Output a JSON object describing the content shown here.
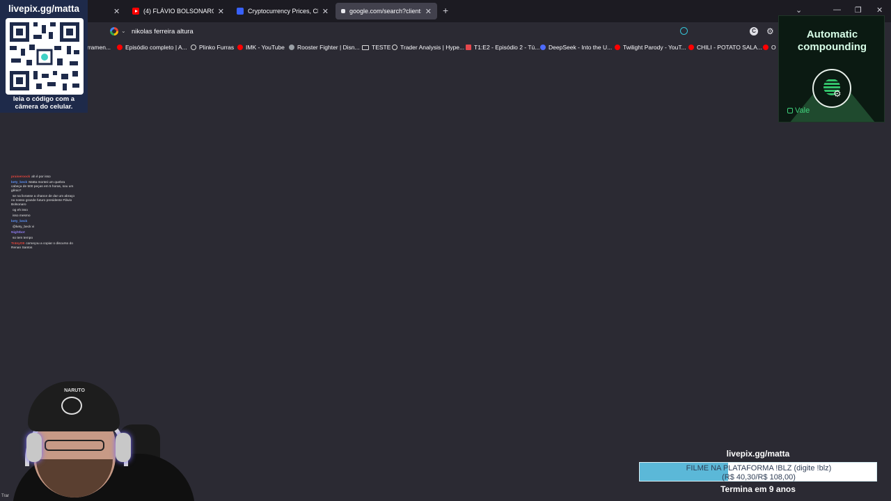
{
  "browser": {
    "tabs": [
      {
        "title": "(4) FLÁVIO BOLSONARO - Intel",
        "favicon": "youtube-icon",
        "active": false
      },
      {
        "title": "Cryptocurrency Prices, Charts A",
        "favicon": "coinmarketcap-icon",
        "active": false
      },
      {
        "title": "google.com/search?client=firef",
        "favicon": "loading-dot-icon",
        "active": true
      }
    ],
    "new_tab_glyph": "+",
    "window_controls": {
      "list": "⌄",
      "minimize": "—",
      "restore": "❐",
      "close": "✕"
    },
    "url_text": "nikolas ferreira altura",
    "ext_c_letter": "C",
    "bookmarks": [
      {
        "label": "rramen...",
        "icon": "none"
      },
      {
        "label": "Episódio completo | A...",
        "icon": "youtube-icon"
      },
      {
        "label": "Plinko Furras",
        "icon": "globe-icon"
      },
      {
        "label": "IMK - YouTube",
        "icon": "youtube-icon"
      },
      {
        "label": "Rooster Fighter | Disn...",
        "icon": "disney-icon"
      },
      {
        "label": "TESTE",
        "icon": "folder-icon"
      },
      {
        "label": "Trader Analysis | Hype...",
        "icon": "globe-icon"
      },
      {
        "label": "T1:E2 - Episódio 2 - Tú...",
        "icon": "star-plus-icon"
      },
      {
        "label": "DeepSeek - Into the U...",
        "icon": "deepseek-icon"
      },
      {
        "label": "Twilight Parody - YouT...",
        "icon": "youtube-icon"
      },
      {
        "label": "CHILI - POTATO SALA...",
        "icon": "youtube-icon"
      },
      {
        "label": "O",
        "icon": "youtube-icon"
      }
    ]
  },
  "overlay": {
    "qr_title": "livepix.gg/matta",
    "qr_caption_line1": "leia o código com a",
    "qr_caption_line2": "câmera do celular.",
    "ad_title_line1": "Automatic",
    "ad_title_line2": "compounding",
    "ad_brand": "Vale",
    "chat": [
      {
        "user": "praiseroock",
        "user_color": "#e0463c",
        "text": "ah é por isso"
      },
      {
        "user": "kety_beck",
        "user_color": "#5b8ff0",
        "text": "Matta montei um quebra cabeça de 500 peças em 5 horas, sou um gênio?"
      },
      {
        "user": "",
        "user_color": "#e0463c",
        "text": "se na livrasse a chance de dar um abraço no nosso grande futuro presidente Flávio Bolsonaro"
      },
      {
        "user": "",
        "user_color": "#5b8ff0",
        "text": "og eh isso"
      },
      {
        "user": "",
        "user_color": "#e0463c",
        "text": "isso mesmo"
      },
      {
        "user": "kety_beck",
        "user_color": "#5b8ff0",
        "text": ""
      },
      {
        "user": "",
        "user_color": "#e0463c",
        "text": "@kety_beck vi"
      },
      {
        "user": "Nightbot",
        "user_color": "#8f7cf0",
        "text": ""
      },
      {
        "user": "",
        "user_color": "#e0463c",
        "text": "so tem tempo"
      },
      {
        "user": "Tr4nyO9",
        "user_color": "#e0463c",
        "text": "começou a copiar o discurso do Renan Santos"
      }
    ],
    "cap_text": "NARUTO",
    "tray_text": "Trar",
    "goal": {
      "url": "livepix.gg/matta",
      "label_line1": "FILME NA PLATAFORMA !BLZ (digite !blz)",
      "label_line2": "(R$ 40,30/R$ 108,00)",
      "progress_fraction": 0.373,
      "footer": "Termina em 9 anos"
    }
  }
}
